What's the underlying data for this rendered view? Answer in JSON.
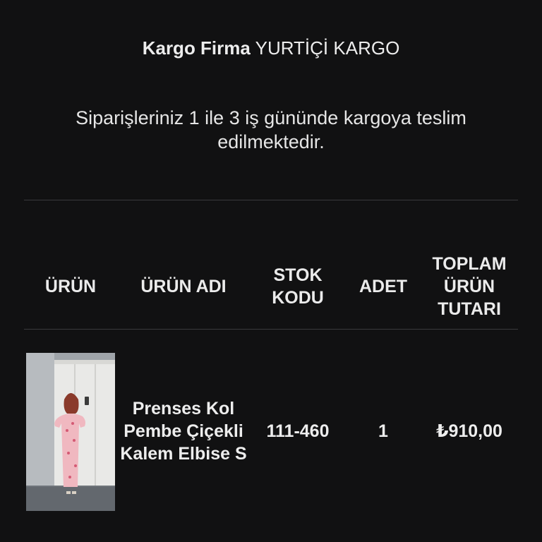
{
  "shipping": {
    "label": "Kargo Firma",
    "company": "YURTİÇİ KARGO"
  },
  "notice": "Siparişleriniz 1 ile 3 iş gününde kargoya teslim edilmektedir.",
  "table": {
    "headers": {
      "product": "ÜRÜN",
      "product_name": "ÜRÜN ADI",
      "stock_code": "STOK KODU",
      "quantity": "ADET",
      "total": "TOPLAM ÜRÜN TUTARI"
    },
    "rows": [
      {
        "image_icon": "product-photo-dress",
        "name": "Prenses Kol Pembe Çiçekli Kalem Elbise S",
        "stock_code": "111-460",
        "quantity": "1",
        "total": "₺910,00"
      }
    ]
  },
  "colors": {
    "background": "#111112",
    "text": "#e8e8e8",
    "divider": "#3a3a3c"
  }
}
